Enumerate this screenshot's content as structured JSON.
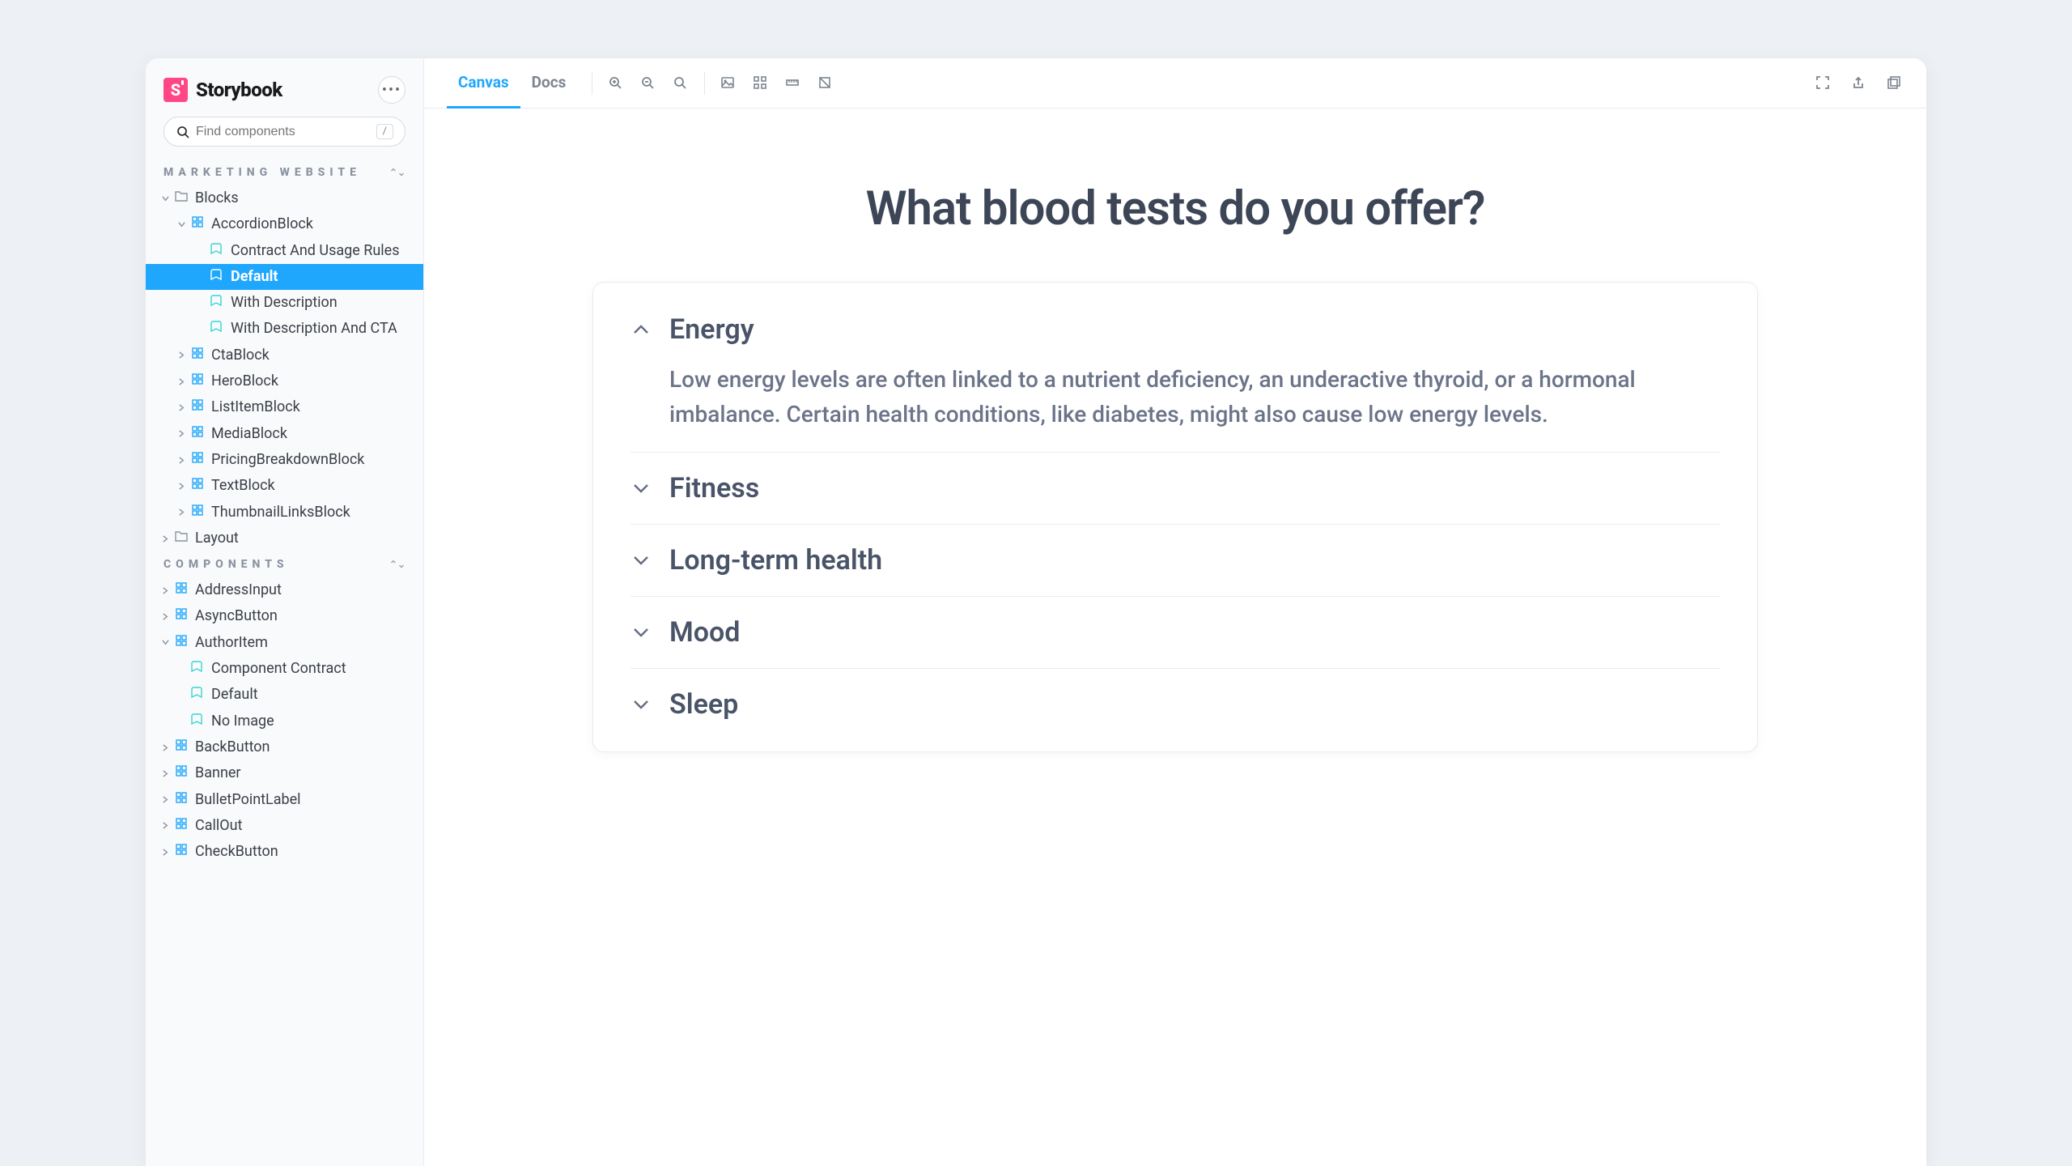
{
  "brand": {
    "name": "Storybook",
    "mark_letter": "S"
  },
  "search": {
    "placeholder": "Find components",
    "shortcut": "/"
  },
  "sections": [
    {
      "label": "MARKETING WEBSITE",
      "nodes": [
        {
          "label": "Blocks",
          "kind": "folder",
          "depth": 0,
          "expanded": true
        },
        {
          "label": "AccordionBlock",
          "kind": "component",
          "depth": 1,
          "expanded": true
        },
        {
          "label": "Contract And Usage Rules",
          "kind": "story",
          "depth": 2
        },
        {
          "label": "Default",
          "kind": "story",
          "depth": 2,
          "selected": true
        },
        {
          "label": "With Description",
          "kind": "story",
          "depth": 2
        },
        {
          "label": "With Description And CTA",
          "kind": "story",
          "depth": 2
        },
        {
          "label": "CtaBlock",
          "kind": "component",
          "depth": 1
        },
        {
          "label": "HeroBlock",
          "kind": "component",
          "depth": 1
        },
        {
          "label": "ListItemBlock",
          "kind": "component",
          "depth": 1
        },
        {
          "label": "MediaBlock",
          "kind": "component",
          "depth": 1
        },
        {
          "label": "PricingBreakdownBlock",
          "kind": "component",
          "depth": 1
        },
        {
          "label": "TextBlock",
          "kind": "component",
          "depth": 1
        },
        {
          "label": "ThumbnailLinksBlock",
          "kind": "component",
          "depth": 1
        },
        {
          "label": "Layout",
          "kind": "folder",
          "depth": 0
        }
      ]
    },
    {
      "label": "COMPONENTS",
      "nodes": [
        {
          "label": "AddressInput",
          "kind": "component",
          "depth": 0
        },
        {
          "label": "AsyncButton",
          "kind": "component",
          "depth": 0
        },
        {
          "label": "AuthorItem",
          "kind": "component",
          "depth": 0,
          "expanded": true
        },
        {
          "label": "Component Contract",
          "kind": "story",
          "depth": 1
        },
        {
          "label": "Default",
          "kind": "story",
          "depth": 1
        },
        {
          "label": "No Image",
          "kind": "story",
          "depth": 1
        },
        {
          "label": "BackButton",
          "kind": "component",
          "depth": 0
        },
        {
          "label": "Banner",
          "kind": "component",
          "depth": 0
        },
        {
          "label": "BulletPointLabel",
          "kind": "component",
          "depth": 0
        },
        {
          "label": "CallOut",
          "kind": "component",
          "depth": 0
        },
        {
          "label": "CheckButton",
          "kind": "component",
          "depth": 0
        }
      ]
    }
  ],
  "tabs": {
    "canvas": "Canvas",
    "docs": "Docs",
    "active": "canvas"
  },
  "preview": {
    "title": "What blood tests do you offer?",
    "items": [
      {
        "title": "Energy",
        "expanded": true,
        "body": "Low energy levels are often linked to a nutrient deficiency, an underactive thyroid, or a hormonal imbalance. Certain health conditions, like diabetes, might also cause low energy levels."
      },
      {
        "title": "Fitness",
        "expanded": false
      },
      {
        "title": "Long-term health",
        "expanded": false
      },
      {
        "title": "Mood",
        "expanded": false
      },
      {
        "title": "Sleep",
        "expanded": false
      }
    ]
  }
}
